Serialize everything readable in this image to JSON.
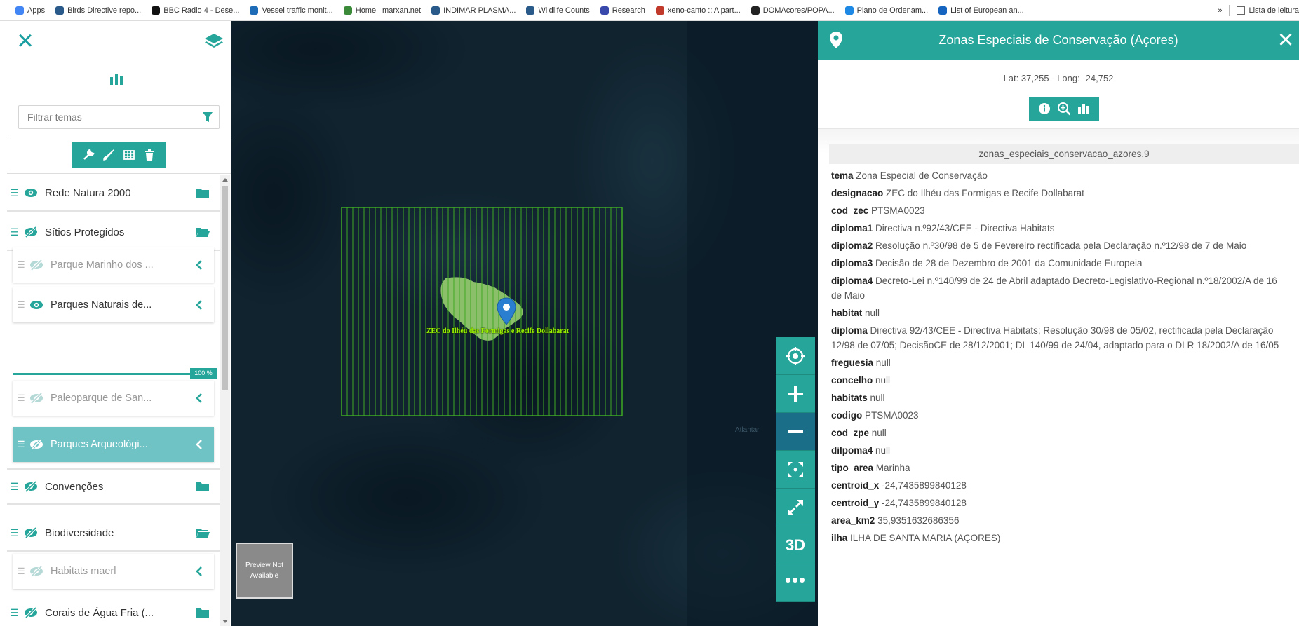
{
  "bookmarks": [
    {
      "label": "Apps",
      "color": "#4285f4"
    },
    {
      "label": "Birds Directive repo...",
      "color": "#2a5a8a"
    },
    {
      "label": "BBC Radio 4 - Dese...",
      "color": "#111111"
    },
    {
      "label": "Vessel traffic monit...",
      "color": "#1e6bb8"
    },
    {
      "label": "Home | marxan.net",
      "color": "#3a8a3a"
    },
    {
      "label": "INDIMAR PLASMA...",
      "color": "#2a5a8a"
    },
    {
      "label": "Wildlife Counts",
      "color": "#2a5a8a"
    },
    {
      "label": "Research",
      "color": "#3949ab"
    },
    {
      "label": "xeno-canto :: A part...",
      "color": "#c0392b"
    },
    {
      "label": "DOMAcores/POPA...",
      "color": "#222222"
    },
    {
      "label": "Plano de Ordenam...",
      "color": "#1e88e5"
    },
    {
      "label": "List of European an...",
      "color": "#1565c0"
    }
  ],
  "bookmarks_overflow": "»",
  "reading_list": "Lista de leitura",
  "left_panel": {
    "filter_placeholder": "Filtrar temas",
    "groups": [
      {
        "label": "Rede Natura 2000",
        "visible": true
      },
      {
        "label": "Sítios Protegidos",
        "visible": false
      },
      {
        "label": "Convenções",
        "visible": false
      },
      {
        "label": "Biodiversidade",
        "visible": false
      },
      {
        "label": "Corais de Água Fria (...",
        "visible": false
      }
    ],
    "sublayers": [
      {
        "label": "Parque Marinho dos ...",
        "visible": false
      },
      {
        "label": "Parques Naturais de...",
        "visible": true
      },
      {
        "label": "Paleoparque de San...",
        "visible": false
      },
      {
        "label": "Parques Arqueológi...",
        "visible": false
      },
      {
        "label": "Habitats maerl",
        "visible": false
      }
    ],
    "opacity": "100 %"
  },
  "map": {
    "feature_label": "ZEC do Ilhéu das Formigas e Recife Dollabarat",
    "ghost_label": "Atlantar",
    "preview_text": "Preview Not Available",
    "controls": {
      "three_d": "3D",
      "more": "•••"
    }
  },
  "right_panel": {
    "title": "Zonas Especiais de Conservação (Açores)",
    "close": "×",
    "coords": "Lat: 37,255 - Long: -24,752",
    "feature_id": "zonas_especiais_conservacao_azores.9",
    "attributes": [
      {
        "key": "tema",
        "value": "Zona Especial de Conservação"
      },
      {
        "key": "designacao",
        "value": "ZEC do Ilhéu das Formigas e Recife Dollabarat"
      },
      {
        "key": "cod_zec",
        "value": "PTSMA0023"
      },
      {
        "key": "diploma1",
        "value": "Directiva n.º92/43/CEE - Directiva Habitats"
      },
      {
        "key": "diploma2",
        "value": "Resolução n.º30/98 de 5 de Fevereiro rectificada pela Declaração n.º12/98 de 7 de Maio"
      },
      {
        "key": "diploma3",
        "value": "Decisão de 28 de Dezembro de 2001 da Comunidade Europeia"
      },
      {
        "key": "diploma4",
        "value": "Decreto-Lei n.º140/99 de 24 de Abril adaptado Decreto-Legislativo-Regional n.º18/2002/A de 16 de Maio"
      },
      {
        "key": "habitat",
        "value": "null"
      },
      {
        "key": "diploma",
        "value": "Directiva 92/43/CEE - Directiva Habitats; Resolução 30/98 de 05/02, rectificada pela Declaração 12/98 de 07/05; DecisãoCE de 28/12/2001; DL 140/99 de 24/04, adaptado para o DLR 18/2002/A de 16/05"
      },
      {
        "key": "freguesia",
        "value": "null"
      },
      {
        "key": "concelho",
        "value": "null"
      },
      {
        "key": "habitats",
        "value": "null"
      },
      {
        "key": "codigo",
        "value": "PTSMA0023"
      },
      {
        "key": "cod_zpe",
        "value": "null"
      },
      {
        "key": "dilpoma4",
        "value": "null"
      },
      {
        "key": "tipo_area",
        "value": "Marinha"
      },
      {
        "key": "centroid_x",
        "value": "-24,7435899840128"
      },
      {
        "key": "centroid_y",
        "value": "-24,7435899840128"
      },
      {
        "key": "area_km2",
        "value": "35,9351632686356"
      },
      {
        "key": "ilha",
        "value": "ILHA DE SANTA MARIA (AÇORES)"
      }
    ]
  },
  "colors": {
    "accent": "#26a69a",
    "accent_light": "#6fc3c5",
    "map_background": "#0f2230",
    "feature_fill": "#8cbf6a",
    "feature_hatch": "#3faa24",
    "label": "#9cf500"
  }
}
